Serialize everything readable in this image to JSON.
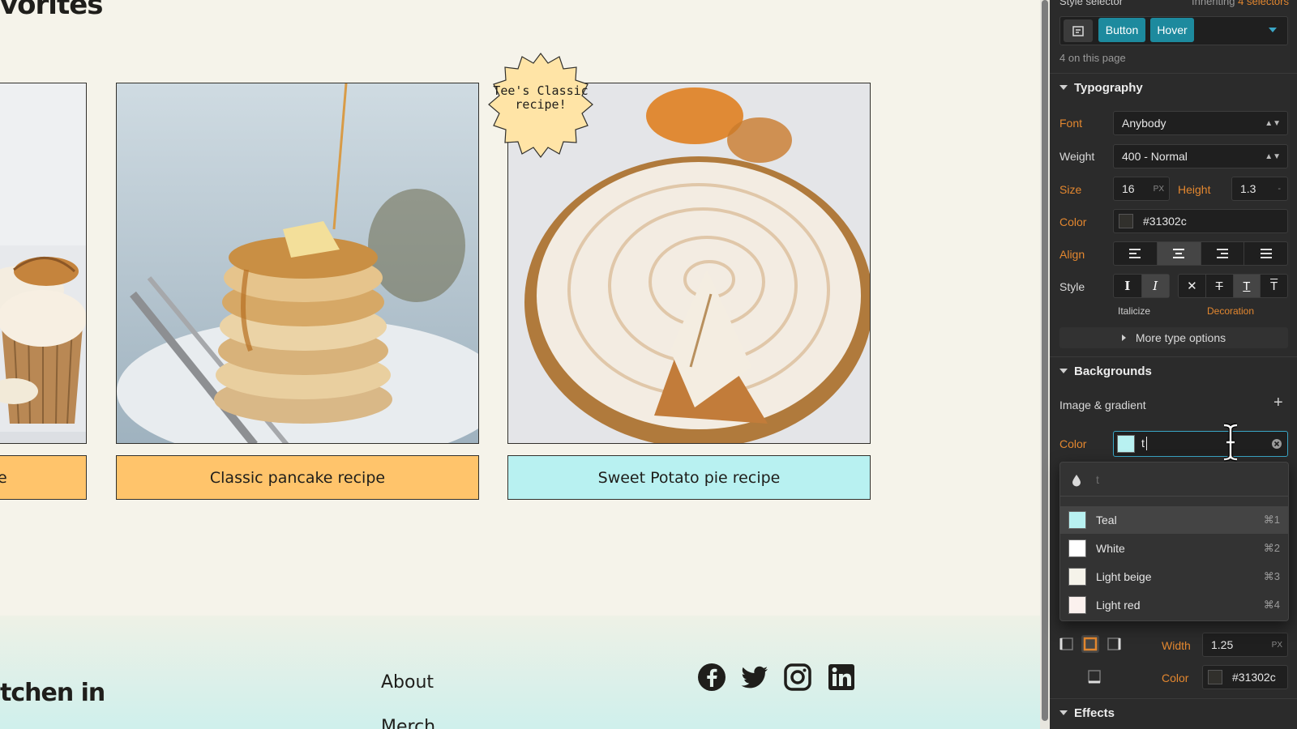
{
  "canvas": {
    "section_title": "vorites",
    "cards": [
      {
        "label": "e",
        "label_bg": "#ffc46b",
        "image_desc": "cupcake"
      },
      {
        "label": "Classic pancake recipe",
        "label_bg": "#ffc46b",
        "image_desc": "pancakes"
      },
      {
        "label": "Sweet Potato pie recipe",
        "label_bg": "#b8f1f1",
        "image_desc": "pie"
      }
    ],
    "badge_text": "Tee's Classic recipe!",
    "footer": {
      "heading": "tchen in",
      "links": [
        "About",
        "Merch"
      ]
    }
  },
  "panel": {
    "style_selector": {
      "label": "Style selector",
      "inheriting_prefix": "Inheriting",
      "inheriting_count": "4 selectors",
      "tags": [
        "Button",
        "Hover"
      ],
      "on_page": "4 on this page"
    },
    "typography": {
      "heading": "Typography",
      "font_label": "Font",
      "font_value": "Anybody",
      "weight_label": "Weight",
      "weight_value": "400 - Normal",
      "size_label": "Size",
      "size_value": "16",
      "size_unit": "PX",
      "height_label": "Height",
      "height_value": "1.3",
      "height_unit": "-",
      "color_label": "Color",
      "color_value": "#31302c",
      "align_label": "Align",
      "style_label": "Style",
      "italicize_label": "Italicize",
      "decoration_label": "Decoration",
      "more_options": "More type options"
    },
    "backgrounds": {
      "heading": "Backgrounds",
      "image_gradient": "Image & gradient",
      "color_label": "Color",
      "color_input": "t",
      "search_text": "t",
      "swatches": [
        {
          "name": "Teal",
          "shortcut": "⌘1",
          "color": "#b8f1f1"
        },
        {
          "name": "White",
          "shortcut": "⌘2",
          "color": "#ffffff"
        },
        {
          "name": "Light beige",
          "shortcut": "⌘3",
          "color": "#f5f3ea"
        },
        {
          "name": "Light red",
          "shortcut": "⌘4",
          "color": "#fbf1ee"
        }
      ]
    },
    "borders": {
      "width_label": "Width",
      "width_value": "1.25",
      "width_unit": "PX",
      "color_label": "Color",
      "color_value": "#31302c"
    },
    "effects": {
      "heading": "Effects"
    }
  },
  "colors": {
    "accent_orange": "#e3872f",
    "tag_teal": "#1d8a9e",
    "panel_bg": "#2b2b2b"
  }
}
